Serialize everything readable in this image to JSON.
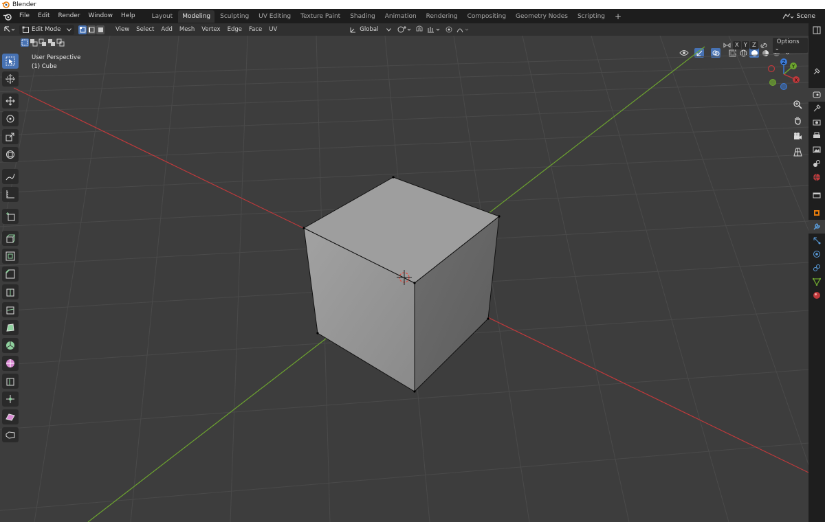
{
  "window": {
    "title": "Blender"
  },
  "menu": [
    "File",
    "Edit",
    "Render",
    "Window",
    "Help"
  ],
  "workspace_tabs": [
    {
      "label": "Layout",
      "active": false
    },
    {
      "label": "Modeling",
      "active": true
    },
    {
      "label": "Sculpting",
      "active": false
    },
    {
      "label": "UV Editing",
      "active": false
    },
    {
      "label": "Texture Paint",
      "active": false
    },
    {
      "label": "Shading",
      "active": false
    },
    {
      "label": "Animation",
      "active": false
    },
    {
      "label": "Rendering",
      "active": false
    },
    {
      "label": "Compositing",
      "active": false
    },
    {
      "label": "Geometry Nodes",
      "active": false
    },
    {
      "label": "Scripting",
      "active": false
    }
  ],
  "add_workspace": "+",
  "scene": {
    "label": "Scene"
  },
  "header": {
    "mode": "Edit Mode",
    "menus": [
      "View",
      "Select",
      "Add",
      "Mesh",
      "Vertex",
      "Edge",
      "Face",
      "UV"
    ],
    "transform_orientation": "Global"
  },
  "viewport": {
    "perspective_label": "User Perspective",
    "object_label": "(1) Cube",
    "axes": [
      "X",
      "Y",
      "Z"
    ],
    "options_label": "Options"
  },
  "gizmo": {
    "x": "X",
    "y": "Y",
    "z": "Z"
  },
  "colors": {
    "accent": "#4772b3",
    "x_axis": "#c0393b",
    "y_axis": "#6da52f",
    "z_axis": "#3b7bd9",
    "background": "#3d3d3d"
  },
  "tools": [
    "select-box-icon",
    "cursor-icon",
    "move-icon",
    "rotate-icon",
    "scale-icon",
    "transform-icon",
    "annotate-icon",
    "measure-icon",
    "add-cube-icon",
    "extrude-icon",
    "inset-icon",
    "bevel-icon",
    "loop-cut-icon",
    "knife-icon",
    "poly-build-icon",
    "spin-icon",
    "smooth-icon",
    "edge-slide-icon",
    "shrink-fatten-icon",
    "shear-icon",
    "rip-icon"
  ]
}
